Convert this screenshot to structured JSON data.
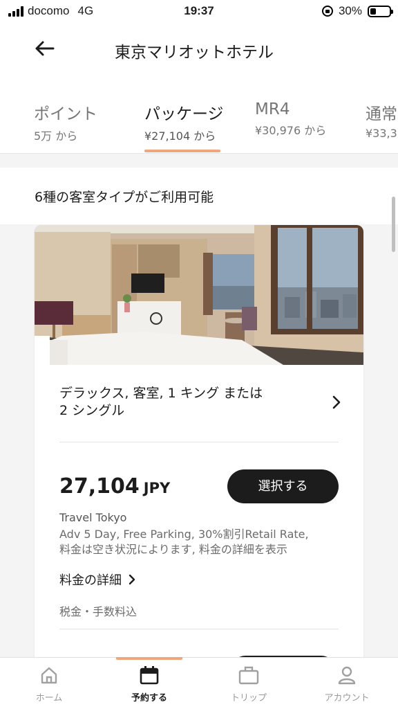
{
  "status_bar": {
    "carrier": "docomo",
    "network": "4G",
    "time": "19:37",
    "battery": "30%",
    "battery_level": 0.3
  },
  "header": {
    "title": "東京マリオットホテル"
  },
  "rate_tabs": [
    {
      "label": "ポイント",
      "price": "5万 から"
    },
    {
      "label": "パッケージ",
      "price": "¥27,104 から"
    },
    {
      "label": "MR4",
      "price": "¥30,976 から"
    },
    {
      "label": "通常",
      "price": "¥33,3"
    }
  ],
  "summary": {
    "text": "6種の客室タイプがご利用可能"
  },
  "room": {
    "name_line1": "デラックス, 客室, 1 キング または",
    "name_line2": "2 シングル",
    "price": "27,104",
    "currency": "JPY",
    "select_label": "選択する",
    "rate_name": "Travel Tokyo",
    "rate_desc_line1": "Adv 5 Day, Free Parking, 30%割引Retail Rate,",
    "rate_desc_line2": "料金は空き状況によります, 料金の詳細を表示",
    "details_label": "料金の詳細",
    "tax_note": "税金・手数料込"
  },
  "bottom_nav": [
    {
      "label": "ホーム",
      "icon": "home-icon"
    },
    {
      "label": "予約する",
      "icon": "calendar-icon"
    },
    {
      "label": "トリップ",
      "icon": "suitcase-icon"
    },
    {
      "label": "アカウント",
      "icon": "person-icon"
    }
  ],
  "colors": {
    "accent": "#f0a57b",
    "primary_button": "#1c1c1c",
    "background": "#f4f4f4"
  }
}
